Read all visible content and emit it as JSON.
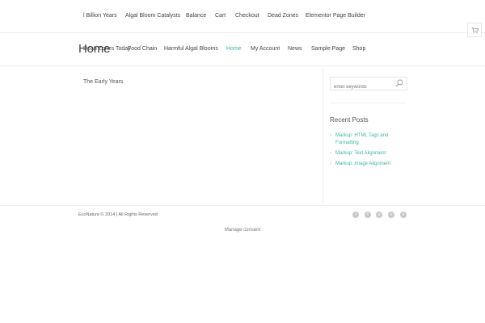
{
  "top_nav": {
    "items": [
      "l Billion Years",
      "Algal Bloom Catalysts",
      "Balance",
      "Cart",
      "Checkout",
      "Dead Zones",
      "Elementor Page Builder"
    ]
  },
  "header": {
    "page_title": "Home",
    "menu": [
      "Dead Zones Today",
      "Food Chain",
      "Harmful Algal Blooms",
      "Home",
      "My Account",
      "News",
      "Sample Page",
      "Shop"
    ],
    "active_item": "Home"
  },
  "main": {
    "link": "The Early Years"
  },
  "sidebar": {
    "search_placeholder": "enter keywords",
    "recent_title": "Recent Posts",
    "posts": [
      "Markup: HTML Tags and Formatting",
      "Markup: Text Alignment",
      "Markup: Image Alignment"
    ]
  },
  "footer": {
    "copyright": "EcoNature © 2014 | All Rights Reserved",
    "socials": [
      "twitter-icon",
      "facebook-icon",
      "pinterest-icon",
      "vimeo-icon",
      "skype-icon"
    ],
    "consent": "Manage consent"
  },
  "colors": {
    "accent": "#3cb6a0",
    "text": "#444444",
    "border": "#eeeeee",
    "social_bg": "#c8c8c8"
  }
}
